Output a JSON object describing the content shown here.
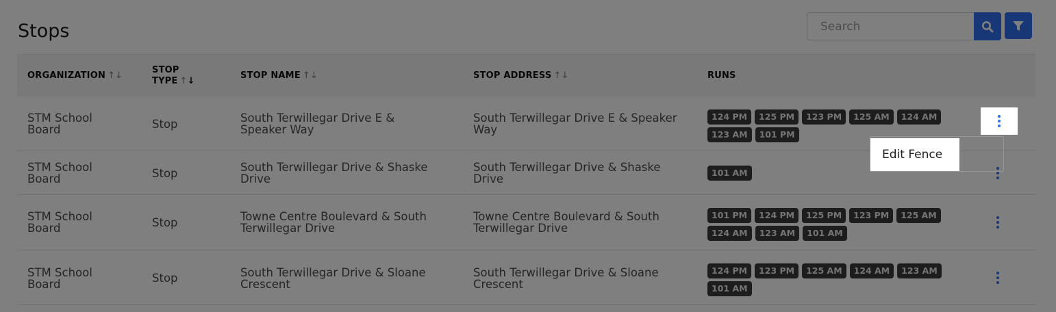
{
  "page": {
    "title": "Stops"
  },
  "search": {
    "placeholder": "Search"
  },
  "icons": {
    "search": "search-icon",
    "filter": "filter-icon",
    "more": "more-vertical-icon",
    "sort": "sort-arrows-icon"
  },
  "colors": {
    "accent": "#2f6fec",
    "badge_bg": "#3a3a3a",
    "overlay": "rgba(0,0,0,0.5)"
  },
  "table": {
    "headers": {
      "organization": "ORGANIZATION",
      "stop_type_line1": "STOP",
      "stop_type_line2": "TYPE",
      "stop_name": "STOP NAME",
      "stop_address": "STOP ADDRESS",
      "runs": "RUNS"
    },
    "rows": [
      {
        "org1": "STM School",
        "org2": "Board",
        "type": "Stop",
        "name1": "South Terwillegar Drive E &",
        "name2": "Speaker Way",
        "addr1": "South Terwillegar Drive E & Speaker",
        "addr2": "Way",
        "runs": [
          "124 PM",
          "125 PM",
          "123 PM",
          "125 AM",
          "124 AM",
          "123 AM",
          "101 PM"
        ]
      },
      {
        "org1": "STM School",
        "org2": "Board",
        "type": "Stop",
        "name1": "South Terwillegar Drive & Shaske",
        "name2": "Drive",
        "addr1": "South Terwillegar Drive & Shaske",
        "addr2": "Drive",
        "runs": [
          "101 AM"
        ]
      },
      {
        "org1": "STM School",
        "org2": "Board",
        "type": "Stop",
        "name1": "Towne Centre Boulevard & South",
        "name2": "Terwillegar Drive",
        "addr1": "Towne Centre Boulevard & South",
        "addr2": "Terwillegar Drive",
        "runs": [
          "101 PM",
          "124 PM",
          "125 PM",
          "123 PM",
          "125 AM",
          "124 AM",
          "123 AM",
          "101 AM"
        ]
      },
      {
        "org1": "STM School",
        "org2": "Board",
        "type": "Stop",
        "name1": "South Terwillegar Drive & Sloane",
        "name2": "Crescent",
        "addr1": "South Terwillegar Drive & Sloane",
        "addr2": "Crescent",
        "runs": [
          "124 PM",
          "123 PM",
          "125 AM",
          "124 AM",
          "123 AM",
          "101 AM"
        ]
      }
    ]
  },
  "context_menu": {
    "items": [
      {
        "label": "Edit Fence"
      }
    ]
  }
}
